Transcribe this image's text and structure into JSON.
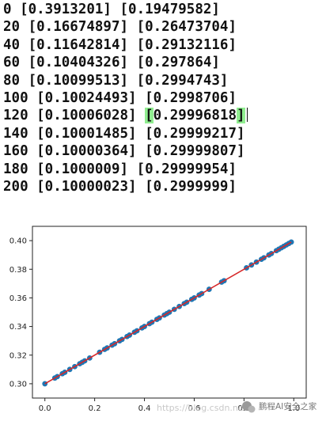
{
  "console": {
    "lines": [
      {
        "before": "0 [0.3913201] [0.19479582]",
        "highlight": "",
        "after": "",
        "caret": false
      },
      {
        "before": "20 [0.16674897] [0.26473704]",
        "highlight": "",
        "after": "",
        "caret": false
      },
      {
        "before": "40 [0.11642814] [0.29132116]",
        "highlight": "",
        "after": "",
        "caret": false
      },
      {
        "before": "60 [0.10404326] [0.297864]",
        "highlight": "",
        "after": "",
        "caret": false
      },
      {
        "before": "80 [0.10099513] [0.2994743]",
        "highlight": "",
        "after": "",
        "caret": false
      },
      {
        "before": "100 [0.10024493] [0.2998706]",
        "highlight": "",
        "after": "",
        "caret": false
      },
      {
        "before": "120 [0.10006028] ",
        "highlight": "[",
        "after": "0.29996818",
        "after_highlight": "]",
        "caret": true
      },
      {
        "before": "140 [0.10001485] [0.29999217]",
        "highlight": "",
        "after": "",
        "caret": false
      },
      {
        "before": "160 [0.10000364] [0.29999807]",
        "highlight": "",
        "after": "",
        "caret": false
      },
      {
        "before": "180 [0.1000009] [0.29999954]",
        "highlight": "",
        "after": "",
        "caret": false
      },
      {
        "before": "200 [0.10000023] [0.2999999]",
        "highlight": "",
        "after": "",
        "caret": false
      }
    ]
  },
  "chart_data": {
    "type": "scatter",
    "title": "",
    "xlabel": "",
    "ylabel": "",
    "xlim": [
      -0.05,
      1.05
    ],
    "ylim": [
      0.29,
      0.41
    ],
    "xticks": [
      0.0,
      0.2,
      0.4,
      0.6,
      0.8,
      1.0
    ],
    "xtick_labels": [
      "0.0",
      "0.2",
      "0.4",
      "0.6",
      "0.8",
      "1.0"
    ],
    "yticks": [
      0.3,
      0.32,
      0.34,
      0.36,
      0.38,
      0.4
    ],
    "ytick_labels": [
      "0.30",
      "0.32",
      "0.34",
      "0.36",
      "0.38",
      "0.40"
    ],
    "grid": false,
    "series": [
      {
        "kind": "scatter",
        "color": "#1f77b4",
        "points": [
          [
            0.0,
            0.3
          ],
          [
            0.04,
            0.304
          ],
          [
            0.05,
            0.305
          ],
          [
            0.07,
            0.307
          ],
          [
            0.08,
            0.308
          ],
          [
            0.1,
            0.31
          ],
          [
            0.12,
            0.312
          ],
          [
            0.14,
            0.314
          ],
          [
            0.15,
            0.315
          ],
          [
            0.16,
            0.316
          ],
          [
            0.18,
            0.318
          ],
          [
            0.22,
            0.322
          ],
          [
            0.24,
            0.324
          ],
          [
            0.25,
            0.325
          ],
          [
            0.27,
            0.327
          ],
          [
            0.28,
            0.328
          ],
          [
            0.3,
            0.33
          ],
          [
            0.31,
            0.331
          ],
          [
            0.33,
            0.333
          ],
          [
            0.34,
            0.334
          ],
          [
            0.36,
            0.336
          ],
          [
            0.37,
            0.337
          ],
          [
            0.39,
            0.339
          ],
          [
            0.4,
            0.34
          ],
          [
            0.42,
            0.342
          ],
          [
            0.43,
            0.343
          ],
          [
            0.45,
            0.345
          ],
          [
            0.46,
            0.346
          ],
          [
            0.48,
            0.348
          ],
          [
            0.49,
            0.349
          ],
          [
            0.5,
            0.35
          ],
          [
            0.52,
            0.352
          ],
          [
            0.54,
            0.354
          ],
          [
            0.56,
            0.356
          ],
          [
            0.57,
            0.357
          ],
          [
            0.59,
            0.359
          ],
          [
            0.6,
            0.36
          ],
          [
            0.62,
            0.362
          ],
          [
            0.63,
            0.363
          ],
          [
            0.66,
            0.366
          ],
          [
            0.71,
            0.371
          ],
          [
            0.72,
            0.372
          ],
          [
            0.81,
            0.381
          ],
          [
            0.83,
            0.383
          ],
          [
            0.85,
            0.385
          ],
          [
            0.87,
            0.387
          ],
          [
            0.88,
            0.388
          ],
          [
            0.9,
            0.39
          ],
          [
            0.91,
            0.391
          ],
          [
            0.93,
            0.393
          ],
          [
            0.94,
            0.394
          ],
          [
            0.95,
            0.395
          ],
          [
            0.96,
            0.396
          ],
          [
            0.97,
            0.397
          ],
          [
            0.98,
            0.398
          ],
          [
            0.99,
            0.399
          ]
        ]
      },
      {
        "kind": "line",
        "color": "#d62728",
        "points": [
          [
            0.0,
            0.3
          ],
          [
            0.99,
            0.399
          ]
        ]
      }
    ]
  },
  "watermark": {
    "url_text": "https://blog.csdn.net",
    "brand_text": "鹏程AI安全之家"
  }
}
